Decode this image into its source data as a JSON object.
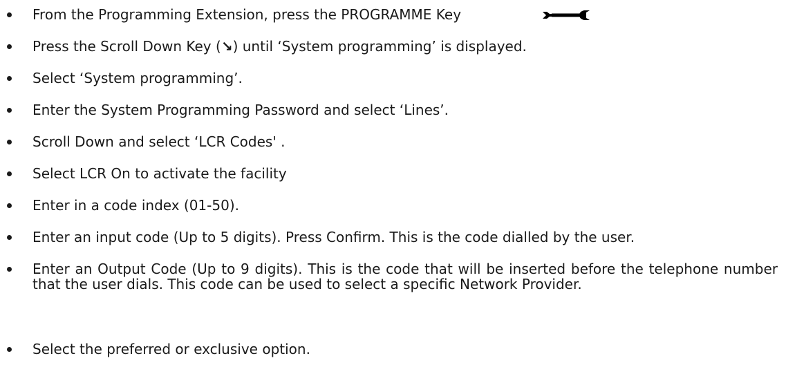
{
  "steps": [
    {
      "text": "From the Programming Extension, press the PROGRAMME Key",
      "icon": "wrench-icon"
    },
    {
      "before": "Press the Scroll Down Key (",
      "arrow": "↘",
      "after": ") until ‘System programming’ is displayed."
    },
    {
      "text": "Select ‘System programming’."
    },
    {
      "text": "Enter the System Programming Password and select ‘Lines’."
    },
    {
      "text": "Scroll Down and select ‘LCR Codes' ."
    },
    {
      "text": "Select LCR On to activate the facility"
    },
    {
      "text": "Enter in a code index (01-50)."
    },
    {
      "text": "Enter an input code (Up to 5 digits). Press Confirm. This is the code dialled by the user."
    },
    {
      "text": "Enter an Output Code (Up to 9 digits). This is the code that will be inserted before the telephone number that the user dials.  This code can be used to select a specific Network Provider."
    },
    {
      "text": "Select the preferred or exclusive option."
    }
  ]
}
